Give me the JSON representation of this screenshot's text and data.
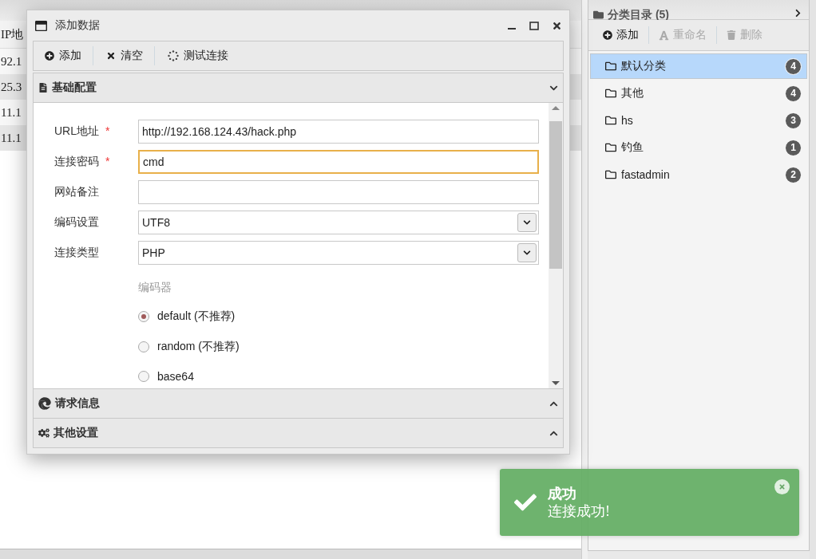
{
  "background_table": {
    "column_header": "IP地",
    "rows": [
      "92.1",
      "25.3",
      "11.1",
      "11.1"
    ]
  },
  "dialog": {
    "title": "添加数据",
    "toolbar": [
      {
        "kind": "add",
        "label": "添加"
      },
      {
        "kind": "clear",
        "label": "清空"
      },
      {
        "kind": "test",
        "label": "测试连接"
      }
    ],
    "sections": [
      {
        "kind": "basic",
        "title": "基础配置",
        "expanded": true,
        "form": {
          "fields": [
            {
              "kind": "text",
              "label": "URL地址",
              "mark": "*",
              "value": "http://192.168.124.43/hack.php",
              "focused": false
            },
            {
              "kind": "text",
              "label": "连接密码",
              "mark": "*",
              "value": "cmd",
              "focused": true
            },
            {
              "kind": "text",
              "label": "网站备注",
              "focused": false
            },
            {
              "kind": "select",
              "label": "编码设置",
              "value": "UTF8",
              "focused": false
            },
            {
              "kind": "select",
              "label": "连接类型",
              "value": "PHP",
              "focused": false
            }
          ],
          "encoder": {
            "label": "编码器",
            "options": [
              {
                "label": "default (不推荐)",
                "selected": true
              },
              {
                "label": "random (不推荐)",
                "selected": false
              },
              {
                "label": "base64",
                "selected": false
              }
            ]
          }
        }
      },
      {
        "kind": "request",
        "title": "请求信息",
        "expanded": false
      },
      {
        "kind": "other",
        "title": "其他设置",
        "expanded": false
      }
    ]
  },
  "category_panel": {
    "title": "分类目录 (5)",
    "toolbar": [
      {
        "kind": "add",
        "label": "添加",
        "disabled": false
      },
      {
        "kind": "rename",
        "label": "重命名",
        "disabled": true
      },
      {
        "kind": "delete",
        "label": "删除",
        "disabled": true
      }
    ],
    "items": [
      {
        "label": "默认分类",
        "count": "4",
        "selected": true
      },
      {
        "label": "其他",
        "count": "4",
        "selected": false
      },
      {
        "label": "hs",
        "count": "3",
        "selected": false
      },
      {
        "label": "钓鱼",
        "count": "1",
        "selected": false
      },
      {
        "label": "fastadmin",
        "count": "2",
        "selected": false
      }
    ]
  },
  "toast": {
    "title": "成功",
    "message": "连接成功!"
  }
}
